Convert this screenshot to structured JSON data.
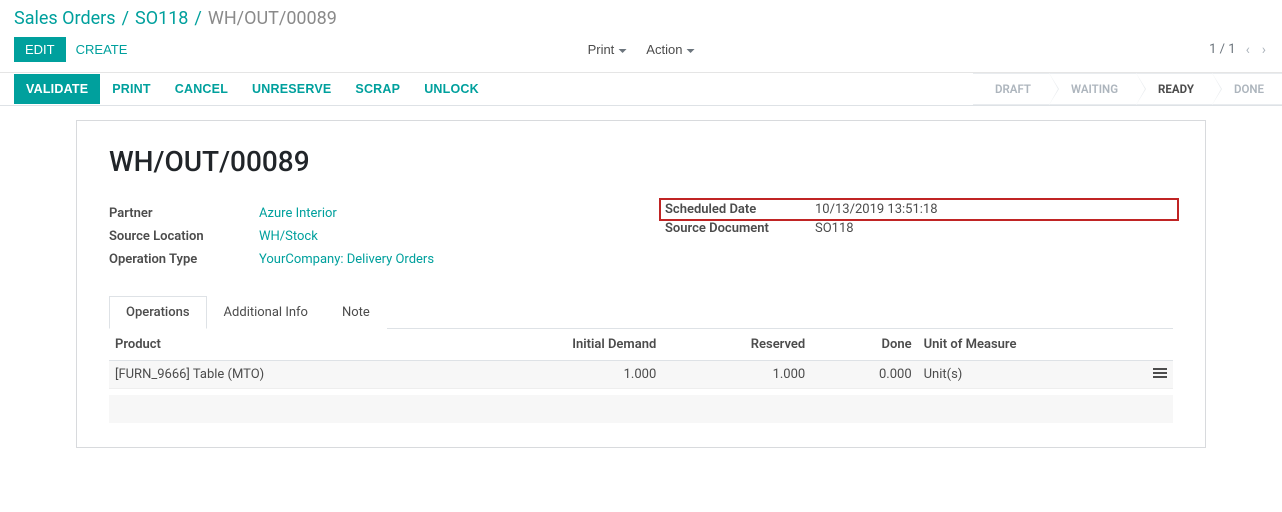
{
  "breadcrumb": {
    "root": "Sales Orders",
    "parent": "SO118",
    "current": "WH/OUT/00089",
    "sep": "/"
  },
  "topbar": {
    "edit": "EDIT",
    "create": "CREATE",
    "print": "Print",
    "action": "Action"
  },
  "pager": {
    "text": "1 / 1"
  },
  "toolbar": {
    "validate": "VALIDATE",
    "print": "PRINT",
    "cancel": "CANCEL",
    "unreserve": "UNRESERVE",
    "scrap": "SCRAP",
    "unlock": "UNLOCK"
  },
  "status": {
    "draft": "DRAFT",
    "waiting": "WAITING",
    "ready": "READY",
    "done": "DONE"
  },
  "record": {
    "title": "WH/OUT/00089",
    "left": {
      "partner_label": "Partner",
      "partner_value": "Azure Interior",
      "source_loc_label": "Source Location",
      "source_loc_value": "WH/Stock",
      "op_type_label": "Operation Type",
      "op_type_value": "YourCompany: Delivery Orders"
    },
    "right": {
      "sched_label": "Scheduled Date",
      "sched_value": "10/13/2019 13:51:18",
      "src_doc_label": "Source Document",
      "src_doc_value": "SO118"
    }
  },
  "tabs": {
    "operations": "Operations",
    "additional": "Additional Info",
    "note": "Note"
  },
  "table": {
    "headers": {
      "product": "Product",
      "initial": "Initial Demand",
      "reserved": "Reserved",
      "done": "Done",
      "uom": "Unit of Measure"
    },
    "rows": [
      {
        "product": "[FURN_9666] Table (MTO)",
        "initial": "1.000",
        "reserved": "1.000",
        "done": "0.000",
        "uom": "Unit(s)"
      }
    ]
  }
}
